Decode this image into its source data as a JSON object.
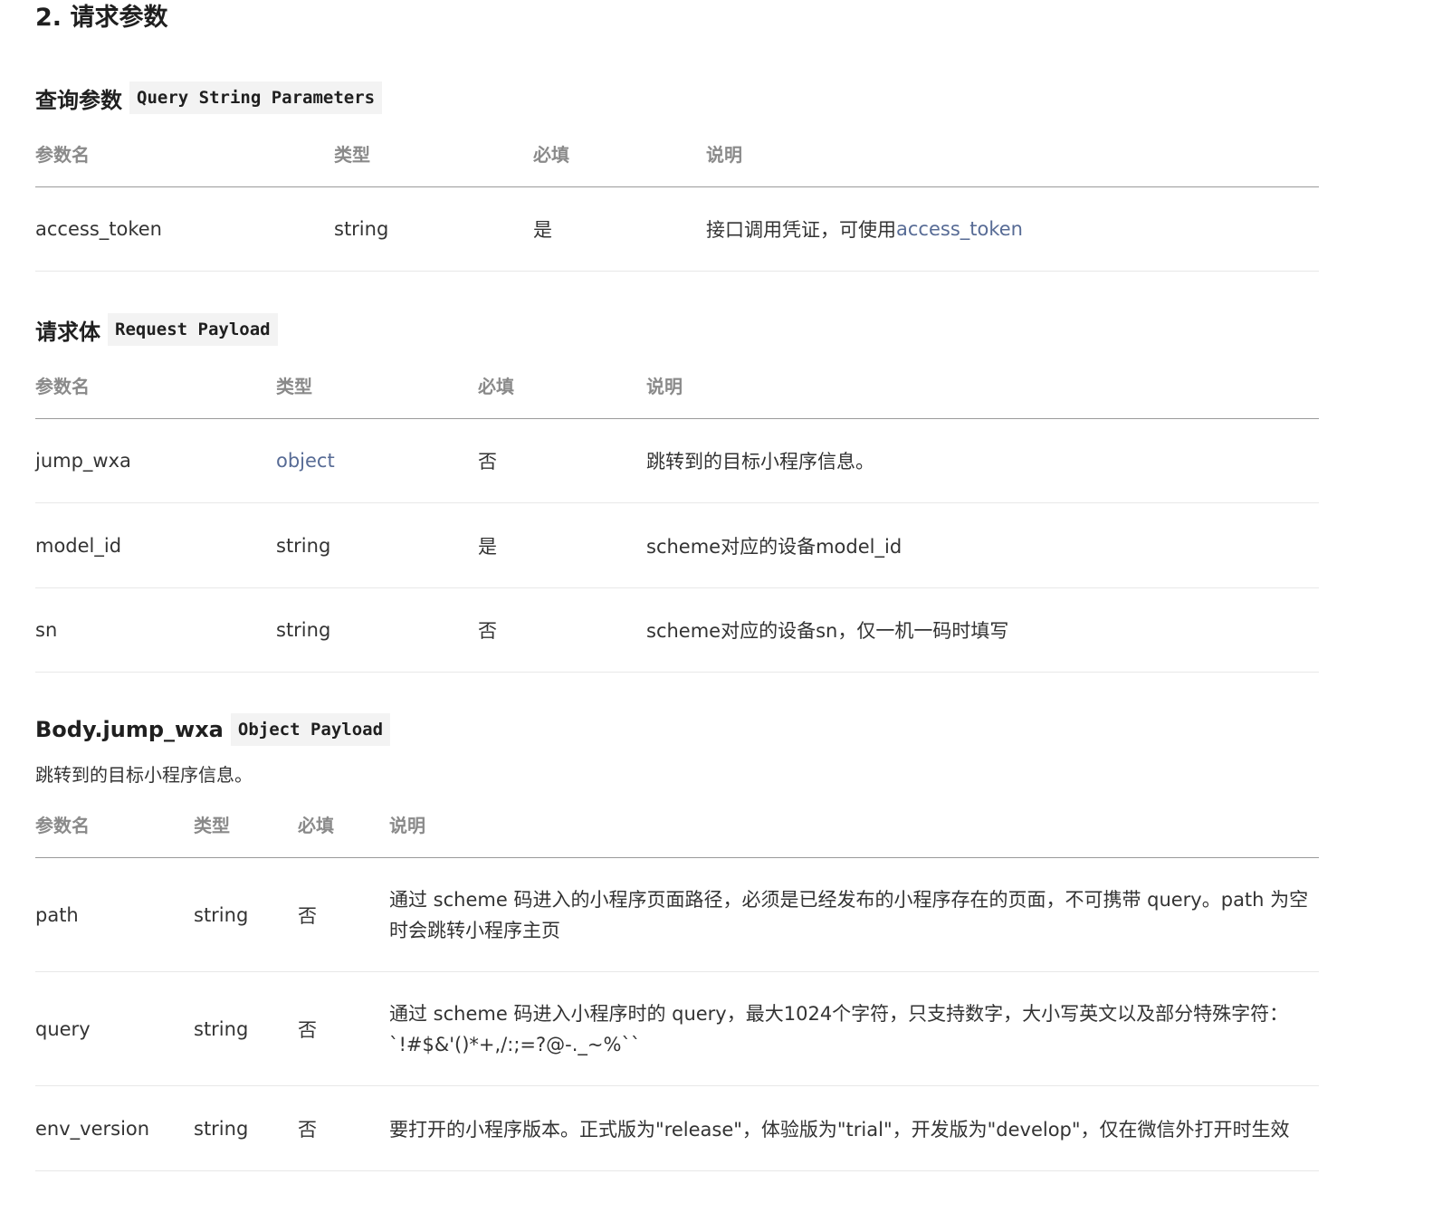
{
  "section_title": "2. 请求参数",
  "query": {
    "title": "查询参数",
    "tag": "Query String Parameters",
    "headers": [
      "参数名",
      "类型",
      "必填",
      "说明"
    ],
    "rows": [
      {
        "name": "access_token",
        "type": "string",
        "required": "是",
        "desc": "接口调用凭证，可使用 ",
        "desc_link": "access_token"
      }
    ]
  },
  "payload": {
    "title": "请求体",
    "tag": "Request Payload",
    "headers": [
      "参数名",
      "类型",
      "必填",
      "说明"
    ],
    "rows": [
      {
        "name": "jump_wxa",
        "type": "object",
        "required": "否",
        "desc": "跳转到的目标小程序信息。"
      },
      {
        "name": "model_id",
        "type": "string",
        "required": "是",
        "desc": "scheme对应的设备model_id"
      },
      {
        "name": "sn",
        "type": "string",
        "required": "否",
        "desc": "scheme对应的设备sn，仅一机一码时填写"
      }
    ]
  },
  "body_jump": {
    "title": "Body.jump_wxa",
    "tag": "Object Payload",
    "description": "跳转到的目标小程序信息。",
    "headers": [
      "参数名",
      "类型",
      "必填",
      "说明"
    ],
    "rows": [
      {
        "name": "path",
        "type": "string",
        "required": "否",
        "desc": "通过 scheme 码进入的小程序页面路径，必须是已经发布的小程序存在的页面，不可携带 query。path 为空时会跳转小程序主页"
      },
      {
        "name": "query",
        "type": "string",
        "required": "否",
        "desc": "通过 scheme 码进入小程序时的 query，最大1024个字符，只支持数字，大小写英文以及部分特殊字符：`!#$&'()*+,/:;=?@-._~%``"
      },
      {
        "name": "env_version",
        "type": "string",
        "required": "否",
        "desc": "要打开的小程序版本。正式版为\"release\"，体验版为\"trial\"，开发版为\"develop\"，仅在微信外打开时生效"
      }
    ]
  },
  "colors": {
    "link": "#576b95",
    "header_text": "#8a8a8a",
    "tag_bg": "#f3f3f3"
  }
}
